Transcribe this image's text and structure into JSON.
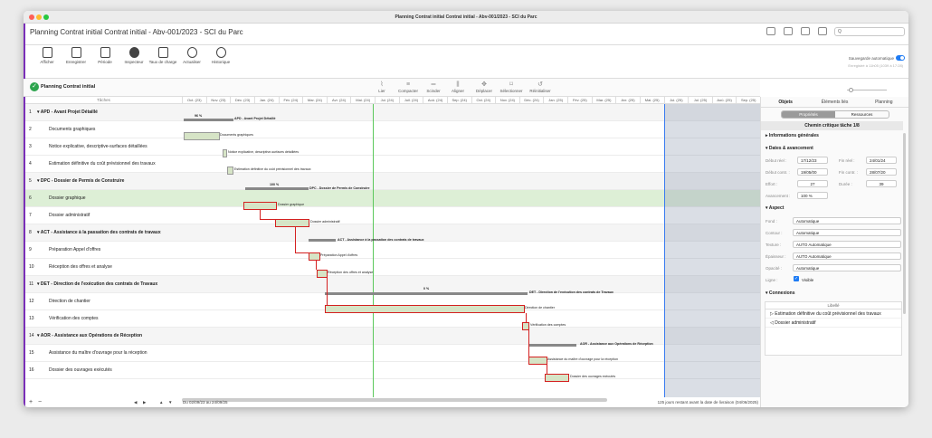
{
  "window": {
    "title": "Planning Contrat initial Contrat initial - Abv-001/2023 - SCI du Parc"
  },
  "header": {
    "doc_title": "Planning Contrat initial Contrat initial - Abv-001/2023 - SCI du Parc",
    "search_placeholder": "Q"
  },
  "toolbar": {
    "items": [
      "Afficher",
      "Enregistrer",
      "Période",
      "Inspecteur",
      "Taux de charge",
      "Actualiser",
      "Historique"
    ]
  },
  "autosave": {
    "label": "Sauvegarde automatique",
    "sub": "Enregistré à 11h05 (1039 à 17:28)"
  },
  "planning_bar": {
    "title": "Planning Contrat initial",
    "actions": [
      "Lier",
      "Compacter",
      "Scinder",
      "Aligner",
      "Déplacer",
      "Sélectionner",
      "Réinitialiser"
    ]
  },
  "tasks_header": "Tâches",
  "months": [
    "Oct. (23)",
    "Nov. (23)",
    "Déc. (23)",
    "Jan. (24)",
    "Fév. (24)",
    "Mar. (24)",
    "Avr. (24)",
    "Mai. (24)",
    "Jui. (24)",
    "Juil. (24)",
    "Aoû. (24)",
    "Sep. (24)",
    "Oct. (24)",
    "Nov. (24)",
    "Déc. (24)",
    "Jan. (25)",
    "Fév. (25)",
    "Mar. (25)",
    "Avr. (25)",
    "Mai. (25)",
    "Jui. (25)",
    "Jul. (25)",
    "Aoû. (25)",
    "Sep. (25)"
  ],
  "tasks": [
    {
      "num": "1",
      "name": "▾ APD - Avant Projet Détaillé",
      "group": true
    },
    {
      "num": "2",
      "name": "Documents graphiques",
      "group": false
    },
    {
      "num": "3",
      "name": "Notice explicative, descriptive-surfaces détaillées",
      "group": false
    },
    {
      "num": "4",
      "name": "Estimation définitive du coût prévisionnel des travaux",
      "group": false
    },
    {
      "num": "5",
      "name": "▾ DPC - Dossier de Permis de Construire",
      "group": true
    },
    {
      "num": "6",
      "name": "Dossier graphique",
      "group": false
    },
    {
      "num": "7",
      "name": "Dossier administratif",
      "group": false
    },
    {
      "num": "8",
      "name": "▾ ACT - Assistance à la passation des contrats de travaux",
      "group": true
    },
    {
      "num": "9",
      "name": "Préparation Appel d'offres",
      "group": false
    },
    {
      "num": "10",
      "name": "Réception des offres et analyse",
      "group": false
    },
    {
      "num": "11",
      "name": "▾ DET - Direction de l'exécution des contrats de Travaux",
      "group": true
    },
    {
      "num": "12",
      "name": "Direction de chantier",
      "group": false
    },
    {
      "num": "13",
      "name": "Vérification des comptes",
      "group": false
    },
    {
      "num": "14",
      "name": "▾ AOR - Assistance aux Opérations de Réception",
      "group": true
    },
    {
      "num": "15",
      "name": "Assistance du maître d'ouvrage pour la réception",
      "group": false
    },
    {
      "num": "16",
      "name": "Dossier des ouvrages exécutés",
      "group": false
    }
  ],
  "gantt_labels": {
    "apd": "APD - Avant Projet Détaillé",
    "apd_pct": "96 %",
    "t2": "Documents graphiques",
    "t3": "Notice explicative, descriptive-surfaces détaillées",
    "t4": "Estimation définitive du coût prévisionnel des travaux",
    "dpc": "DPC - Dossier de Permis de Construire",
    "dpc_pct": "100 %",
    "t6": "Dossier graphique",
    "t7": "Dossier administratif",
    "act": "ACT - Assistance à la passation des contrats de travaux",
    "t9": "Préparation Appel d'offres",
    "t10": "Réception des offres et analyse",
    "det": "DET - Direction de l'exécution des contrats de Travaux",
    "det_pct": "0 %",
    "t12": "Direction de chantier",
    "t13": "Vérification des comptes",
    "aor": "AOR - Assistance aux Opérations de Réception",
    "t15": "Assistance du maître d'ouvrage pour la réception",
    "t16": "Dossier des ouvrages exécutés"
  },
  "footer": {
    "plus": "+",
    "minus": "−",
    "period": "Du 02/09/23 au 24/09/25",
    "remaining": "125 jours restant avant la date de livraison (04/06/2025)"
  },
  "sidebar": {
    "tabs": [
      "Objets",
      "Éléments liés",
      "Planning"
    ],
    "seg": [
      "Propriétés",
      "Ressources"
    ],
    "chemin": "Chemin critique tâche 1/8",
    "sections": {
      "info": "Informations générales",
      "dates": "Dates & avancement",
      "aspect": "Aspect",
      "connexions": "Connexions"
    },
    "dates": {
      "debut_reel_l": "Début réel :",
      "debut_reel": "17/12/23",
      "fin_reel_l": "Fin réel :",
      "fin_reel": "24/01/24",
      "debut_contr_l": "Début contr. :",
      "debut_contr": "19/05/00",
      "fin_contr_l": "Fin contr. :",
      "fin_contr": "28/07/20",
      "effort_l": "Effort :",
      "effort": "27",
      "duree_l": "Durée :",
      "duree": "39",
      "avancement_l": "Avancement :",
      "avancement": "100 %"
    },
    "aspect": {
      "fond_l": "Fond :",
      "fond": "Automatique",
      "contour_l": "Contour :",
      "contour": "Automatique",
      "texture_l": "Texture :",
      "texture": "AUTO Automatique",
      "epaisseur_l": "Épaisseur :",
      "epaisseur": "AUTO Automatique",
      "opacite_l": "Opacité :",
      "opacite": "Automatique",
      "ligne_l": "Ligne :",
      "ligne": "Visible"
    },
    "conn_header": "Libellé",
    "connexions": [
      "Estimation définitive du coût prévisionnel des travaux",
      "Dossier administratif"
    ]
  }
}
